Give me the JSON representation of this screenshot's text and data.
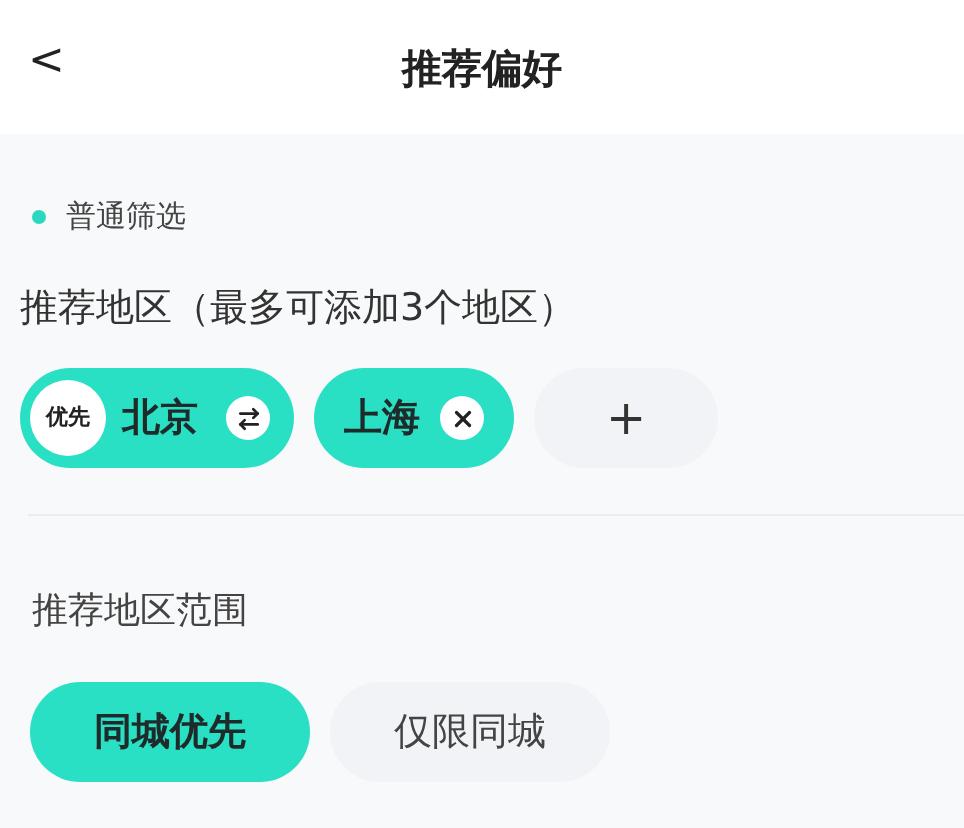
{
  "header": {
    "back": "<",
    "title": "推荐偏好"
  },
  "section": {
    "label": "普通筛选",
    "color": "#2ad8c0"
  },
  "regions": {
    "title": "推荐地区（最多可添加3个地区）",
    "items": [
      {
        "name": "北京",
        "kind": "priority",
        "badge": "优先"
      },
      {
        "name": "上海",
        "kind": "removable"
      }
    ],
    "add_label": "+"
  },
  "range": {
    "title": "推荐地区范围",
    "options": [
      {
        "label": "同城优先",
        "selected": true
      },
      {
        "label": "仅限同城",
        "selected": false
      }
    ]
  }
}
